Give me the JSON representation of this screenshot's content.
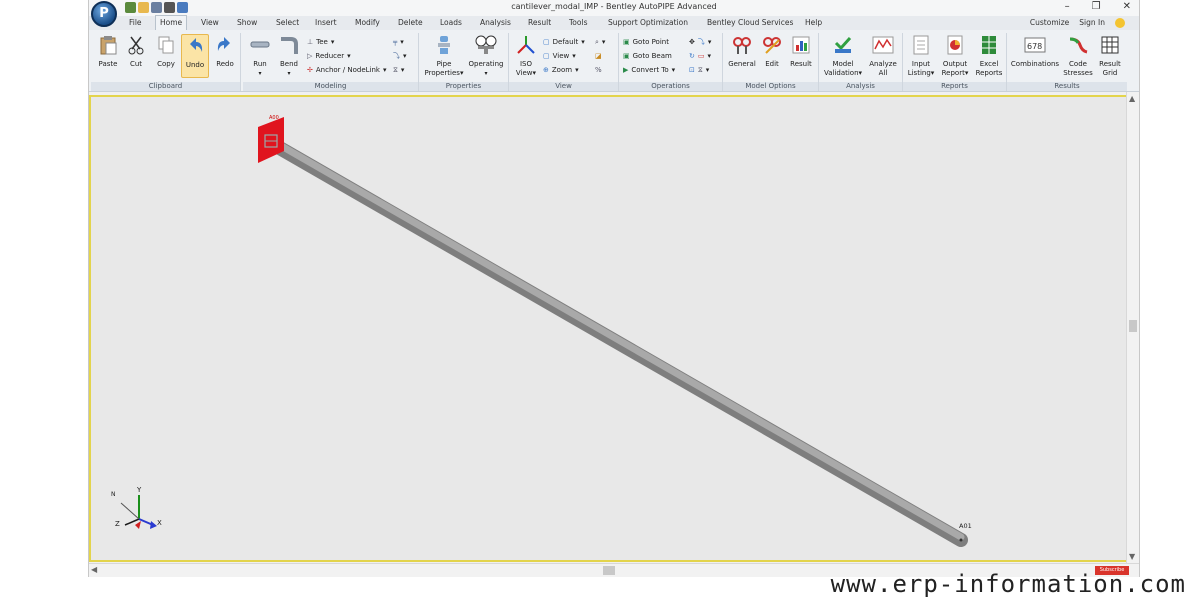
{
  "window": {
    "title": "cantilever_modal_IMP - Bentley AutoPIPE Advanced",
    "minimize": "–",
    "maximize": "❐",
    "close": "✕"
  },
  "tabs": [
    "File",
    "Home",
    "View",
    "Show",
    "Select",
    "Insert",
    "Modify",
    "Delete",
    "Loads",
    "Analysis",
    "Result",
    "Tools",
    "Support Optimization",
    "Bentley Cloud Services",
    "Help"
  ],
  "active_tab": "Home",
  "tab_right": {
    "customize": "Customize",
    "sign_in": "Sign In"
  },
  "ribbon": {
    "clipboard": {
      "label": "Clipboard",
      "paste": "Paste",
      "cut": "Cut",
      "copy": "Copy",
      "undo": "Undo",
      "redo": "Redo"
    },
    "modeling": {
      "label": "Modeling",
      "run": "Run",
      "bend": "Bend",
      "tee": "Tee",
      "reducer": "Reducer",
      "anchor": "Anchor / NodeLink"
    },
    "properties": {
      "label": "Properties",
      "pipe": "Pipe",
      "pipe2": "Properties",
      "operating": "Operating"
    },
    "view": {
      "label": "View",
      "iso": "ISO",
      "iso2": "View",
      "default": "Default",
      "view": "View",
      "zoom": "Zoom"
    },
    "operations": {
      "label": "Operations",
      "goto_point": "Goto Point",
      "goto_beam": "Goto Beam",
      "convert_to": "Convert To"
    },
    "model_options": {
      "label": "Model Options",
      "general": "General",
      "edit": "Edit",
      "result": "Result"
    },
    "analysis": {
      "label": "Analysis",
      "model_validation": "Model",
      "model_validation2": "Validation",
      "analyze_all": "Analyze",
      "analyze_all2": "All"
    },
    "reports": {
      "label": "Reports",
      "input_listing": "Input",
      "input_listing2": "Listing",
      "output_report": "Output",
      "output_report2": "Report",
      "excel_reports": "Excel",
      "excel_reports2": "Reports"
    },
    "results": {
      "label": "Results",
      "combinations": "Combinations",
      "code_stresses": "Code",
      "code_stresses2": "Stresses",
      "result_grid": "Result",
      "result_grid2": "Grid"
    }
  },
  "model": {
    "node_start": "A00",
    "node_end": "A01",
    "axes": {
      "x": "X",
      "y": "Y",
      "z": "Z",
      "n": "N"
    }
  },
  "colors": {
    "pipe": "#9a9a9a",
    "anchor": "#e0141e",
    "viewport_border": "#e3d44c"
  },
  "badge": "Subscribe",
  "watermark": "www.erp-information.com"
}
